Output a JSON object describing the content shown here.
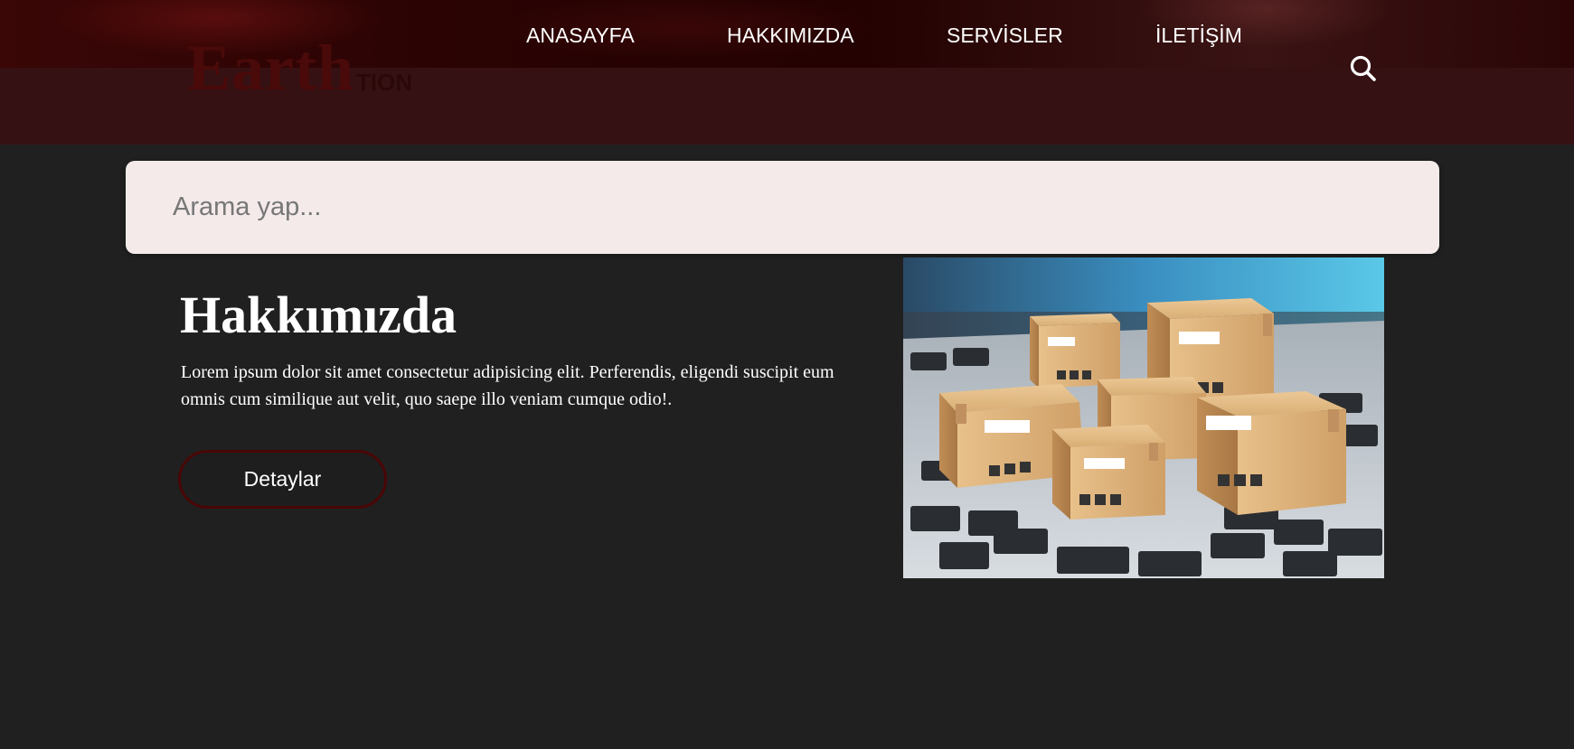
{
  "header": {
    "logo": {
      "main": "Earth",
      "sub": "TION"
    },
    "nav": [
      {
        "label": "ANASAYFA"
      },
      {
        "label": "HAKKIMIZDA"
      },
      {
        "label": "SERVİSLER"
      },
      {
        "label": "İLETİŞİM"
      }
    ],
    "search_icon": "search-icon"
  },
  "search": {
    "placeholder": "Arama yap..."
  },
  "about": {
    "title": "Hakkımızda",
    "text": "Lorem ipsum dolor sit amet consectetur adipisicing elit. Perferendis, eligendi suscipit eum omnis cum similique aut velit, quo saepe illo veniam cumque odio!.",
    "button_label": "Detaylar"
  },
  "image": {
    "subject": "cardboard-boxes-on-laptop-keyboard"
  },
  "colors": {
    "header_bg": "#361113",
    "page_bg": "#202020",
    "search_bg": "#f4eaea",
    "button_border": "#4a0606"
  }
}
